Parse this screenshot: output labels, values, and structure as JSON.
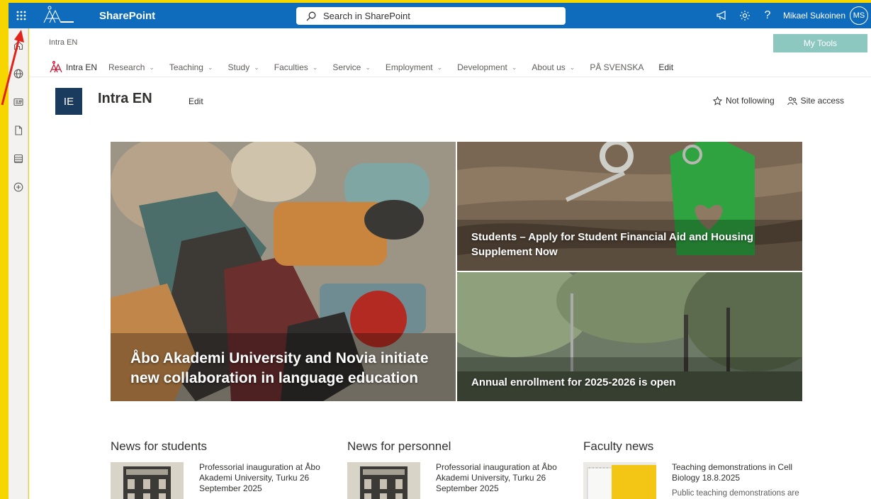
{
  "suitebar": {
    "app_name": "SharePoint",
    "search_placeholder": "Search in SharePoint",
    "user_name": "Mikael Sukoinen",
    "user_initials": "MS"
  },
  "hub": {
    "breadcrumb": "Intra EN",
    "logo_label": "Intra EN",
    "my_tools": "My Tools",
    "nav": [
      {
        "label": "Research",
        "dropdown": true
      },
      {
        "label": "Teaching",
        "dropdown": true
      },
      {
        "label": "Study",
        "dropdown": true
      },
      {
        "label": "Faculties",
        "dropdown": true
      },
      {
        "label": "Service",
        "dropdown": true
      },
      {
        "label": "Employment",
        "dropdown": true
      },
      {
        "label": "Development",
        "dropdown": true
      },
      {
        "label": "About us",
        "dropdown": true
      },
      {
        "label": "PÅ SVENSKA",
        "dropdown": false
      }
    ],
    "nav_edit": "Edit"
  },
  "site": {
    "tile_initials": "IE",
    "title": "Intra EN",
    "edit": "Edit",
    "follow": "Not following",
    "access": "Site access"
  },
  "hero": {
    "main": "Åbo Akademi University and Novia initiate new collaboration in language education",
    "top_right": "Students – Apply for Student Financial Aid and Housing Supplement Now",
    "bottom_right": "Annual enrollment for 2025-2026 is open"
  },
  "news": [
    {
      "heading": "News for students",
      "title": "Professorial inauguration at Åbo Akademi University, Turku 26 September 2025",
      "desc": ""
    },
    {
      "heading": "News for personnel",
      "title": "Professorial inauguration at Åbo Akademi University, Turku 26 September 2025",
      "desc": ""
    },
    {
      "heading": "Faculty news",
      "title": "Teaching demonstrations in Cell Biology 18.8.2025",
      "desc": "Public teaching demonstrations are"
    }
  ],
  "colors": {
    "suitebar": "#0f6cbd",
    "frame": "#f7d600",
    "my_tools": "#8cc7c0",
    "site_tile": "#1a3b5d"
  }
}
